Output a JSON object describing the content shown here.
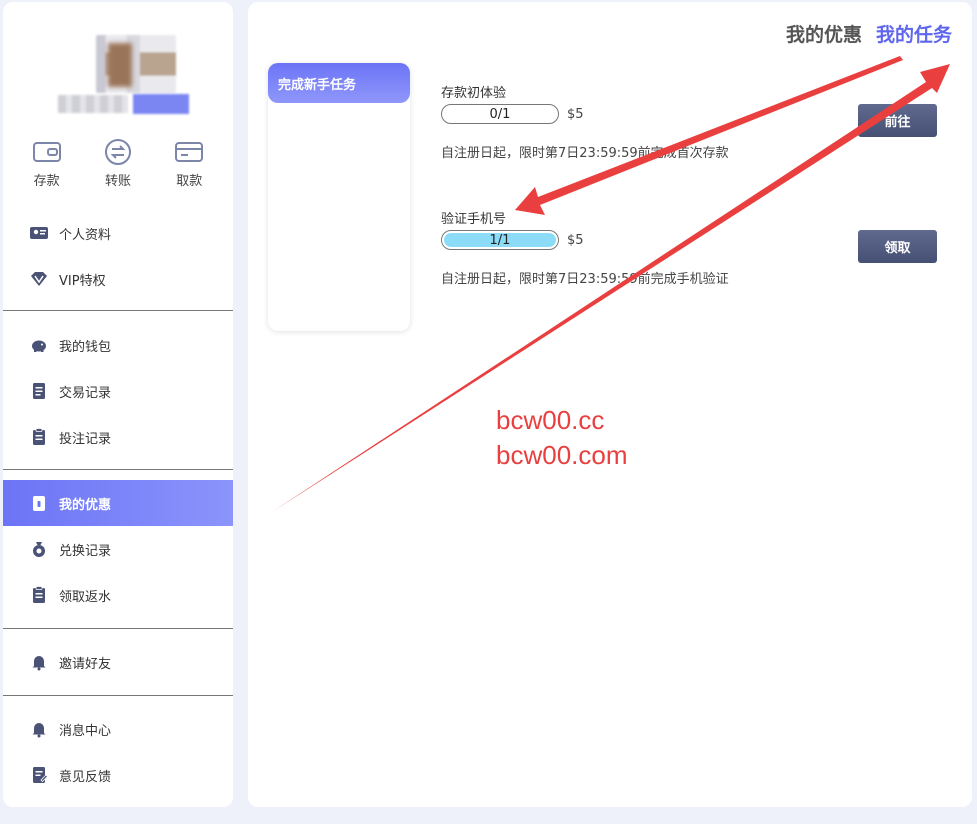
{
  "sidebar": {
    "quick_actions": [
      {
        "label": "存款",
        "icon": "wallet-icon"
      },
      {
        "label": "转账",
        "icon": "transfer-icon"
      },
      {
        "label": "取款",
        "icon": "card-icon"
      }
    ],
    "groups": [
      [
        {
          "label": "个人资料",
          "icon": "id-card-icon"
        },
        {
          "label": "VIP特权",
          "icon": "diamond-icon"
        }
      ],
      [
        {
          "label": "我的钱包",
          "icon": "piggy-bank-icon"
        },
        {
          "label": "交易记录",
          "icon": "document-icon"
        },
        {
          "label": "投注记录",
          "icon": "clipboard-icon"
        }
      ],
      [
        {
          "label": "我的优惠",
          "icon": "gift-icon",
          "active": true
        },
        {
          "label": "兑换记录",
          "icon": "money-bag-icon"
        },
        {
          "label": "领取返水",
          "icon": "clipboard-icon"
        }
      ],
      [
        {
          "label": "邀请好友",
          "icon": "bell-icon"
        }
      ],
      [
        {
          "label": "消息中心",
          "icon": "bell-icon"
        },
        {
          "label": "意见反馈",
          "icon": "feedback-icon"
        }
      ]
    ]
  },
  "tabs": [
    {
      "label": "我的优惠",
      "active": false
    },
    {
      "label": "我的任务",
      "active": true
    }
  ],
  "task_category": "完成新手任务",
  "tasks": [
    {
      "title": "存款初体验",
      "progress_text": "0/1",
      "progress_fraction": 0,
      "reward": "$5",
      "description": "自注册日起，限时第7日23:59:59前完成首次存款",
      "button": "前往"
    },
    {
      "title": "验证手机号",
      "progress_text": "1/1",
      "progress_fraction": 1,
      "reward": "$5",
      "description": "自注册日起，限时第7日23:59:59前完成手机验证",
      "button": "领取"
    }
  ],
  "watermark": [
    "bcw00.cc",
    "bcw00.com"
  ],
  "colors": {
    "accent": "#5f66ee",
    "button": "#4e5879",
    "progress_fill": "#8ddcf7",
    "annotation": "#ea3f3f"
  }
}
